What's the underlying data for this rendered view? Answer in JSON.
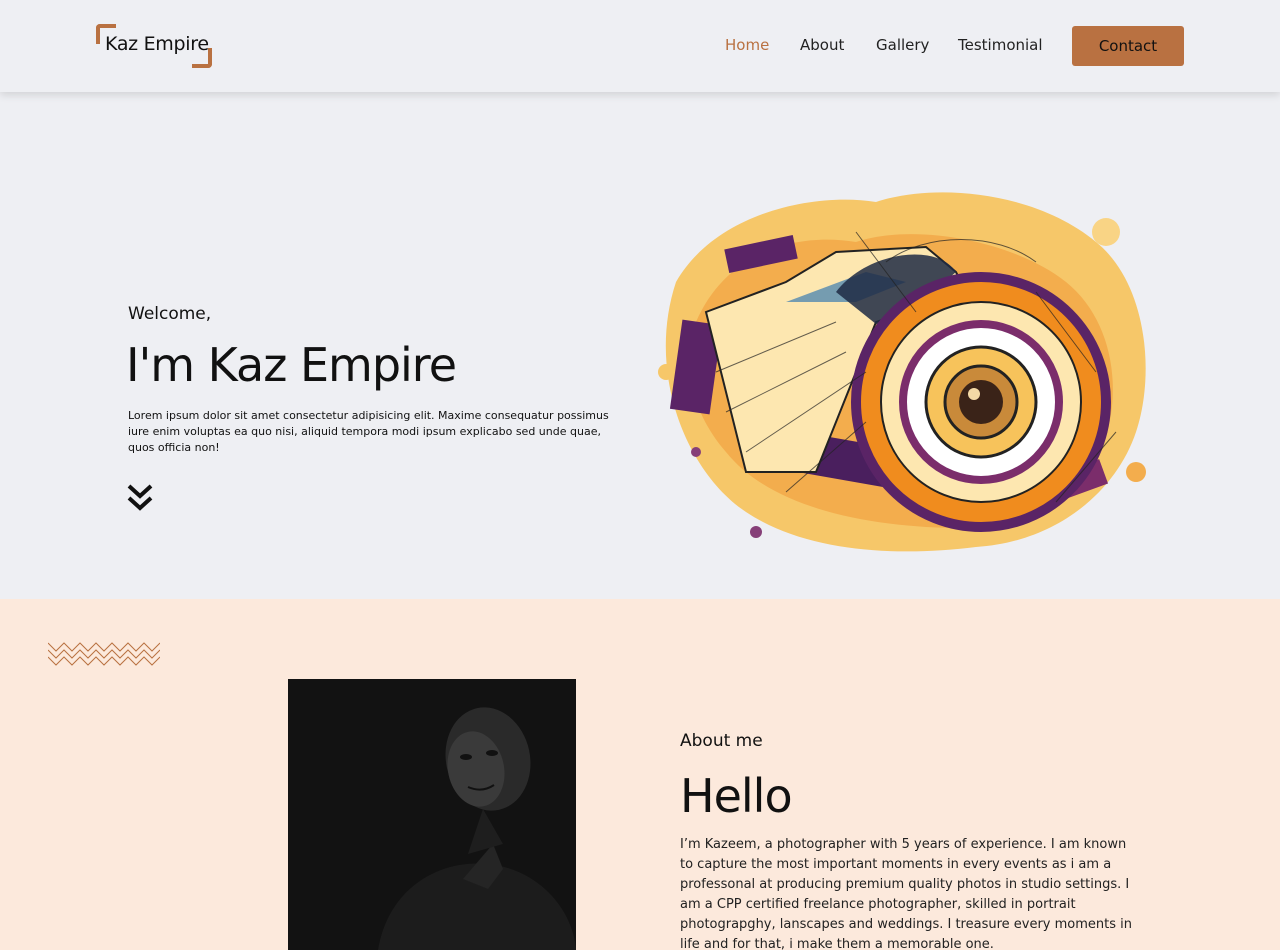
{
  "header": {
    "logo_text": "Kaz Empire",
    "nav": [
      {
        "label": "Home",
        "active": true
      },
      {
        "label": "About",
        "active": false
      },
      {
        "label": "Gallery",
        "active": false
      },
      {
        "label": "Testimonial",
        "active": false
      }
    ],
    "contact_label": "Contact"
  },
  "hero": {
    "welcome": "Welcome,",
    "title": "I'm Kaz Empire",
    "description": "Lorem ipsum dolor sit amet consectetur adipisicing elit. Maxime consequatur possimus iure enim voluptas ea quo nisi, aliquid tempora modi ipsum explicabo sed unde quae, quos officia non!",
    "scroll_icon": "chevron-double-down-icon",
    "image": "camera-paint-splash-illustration"
  },
  "about": {
    "decoration": "zigzag-lines",
    "portrait": "portrait-photo-man-dark",
    "label": "About me",
    "title": "Hello",
    "text": "I’m Kazeem, a photographer with 5 years of experience. I am known to capture the most important moments in every events as i am a professonal at producing premium quality photos in studio settings. I am a CPP certified freelance photographer, skilled in portrait photograpghy, lanscapes and weddings. I treasure every moments in life and for that, i make them a memorable one."
  },
  "colors": {
    "accent": "#b97141",
    "page_bg": "#eeeff3",
    "about_bg": "#fce9dc",
    "text": "#111111"
  }
}
